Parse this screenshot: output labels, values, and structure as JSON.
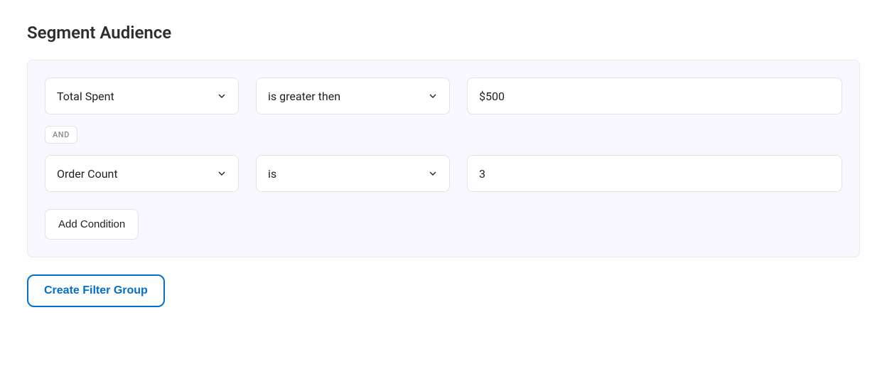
{
  "title": "Segment Audience",
  "filterGroup": {
    "conditions": [
      {
        "field": "Total Spent",
        "operator": "is greater then",
        "value": "$500"
      },
      {
        "field": "Order Count",
        "operator": "is",
        "value": "3"
      }
    ],
    "logic": "AND",
    "addConditionLabel": "Add Condition"
  },
  "createGroupLabel": "Create Filter Group"
}
